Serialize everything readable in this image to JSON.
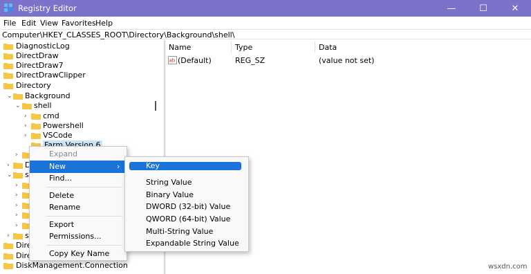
{
  "window": {
    "title": "Registry Editor",
    "minimize_glyph": "—",
    "maximize_glyph": "☐",
    "close_glyph": "✕",
    "titlebar_color": "#7b73c9"
  },
  "menu": {
    "file": "File",
    "edit": "Edit",
    "view": "View",
    "favorites": "Favorites",
    "help": "Help"
  },
  "address": "Computer\\HKEY_CLASSES_ROOT\\Directory\\Background\\shell\\",
  "tree": {
    "diagnosticlog": "DiagnosticLog",
    "directdraw": "DirectDraw",
    "directdraw7": "DirectDraw7",
    "directdrawclipper": "DirectDrawClipper",
    "directory": "Directory",
    "background": "Background",
    "shell": "shell",
    "cmd": "cmd",
    "powershell": "Powershell",
    "vscode": "VSCode",
    "new_key": "Farm Version 6",
    "partial_d": "D",
    "partial_s1": "s",
    "partial_s2": "s",
    "dire1": "Dire",
    "dire2": "Dire",
    "diskmanagement": "DiskManagement.Connection",
    "chevron_right": "›",
    "chevron_down": "⌄"
  },
  "list": {
    "headers": {
      "name": "Name",
      "type": "Type",
      "data": "Data"
    },
    "rows": [
      {
        "icon": "ab",
        "name": "(Default)",
        "type": "REG_SZ",
        "data": "(value not set)"
      }
    ]
  },
  "context_menu": {
    "expand": "Expand",
    "new": "New",
    "new_arrow": "›",
    "find": "Find...",
    "delete": "Delete",
    "rename": "Rename",
    "export": "Export",
    "permissions": "Permissions...",
    "copy_key_name": "Copy Key Name"
  },
  "new_submenu": {
    "key": "Key",
    "string_value": "String Value",
    "binary_value": "Binary Value",
    "dword_value": "DWORD (32-bit) Value",
    "qword_value": "QWORD (64-bit) Value",
    "multi_string_value": "Multi-String Value",
    "expandable_string_value": "Expandable String Value"
  },
  "watermark": "wsxdn.com",
  "colors": {
    "highlight": "#1a73d8",
    "folder": "#f6c644",
    "selection": "#cce4f7"
  }
}
